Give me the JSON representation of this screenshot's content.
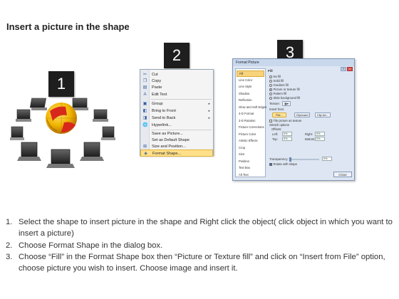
{
  "title": "Insert a picture in the shape",
  "steps": {
    "s1": {
      "number": "1"
    },
    "s2": {
      "number": "2"
    },
    "s3": {
      "number": "3"
    }
  },
  "context_menu": {
    "items": [
      {
        "label": "Cut",
        "icon": "scissors-icon"
      },
      {
        "label": "Copy",
        "icon": "copy-icon"
      },
      {
        "label": "Paste",
        "icon": "paste-icon"
      },
      {
        "label": "Edit Text",
        "icon": "edit-text-icon"
      },
      {
        "label": "Group",
        "icon": "group-icon"
      },
      {
        "label": "Bring to Front",
        "icon": "bring-front-icon"
      },
      {
        "label": "Send to Back",
        "icon": "send-back-icon"
      },
      {
        "label": "Hyperlink...",
        "icon": "hyperlink-icon"
      },
      {
        "label": "Save as Picture...",
        "icon": ""
      },
      {
        "label": "Set as Default Shape",
        "icon": ""
      },
      {
        "label": "Size and Position...",
        "icon": "size-position-icon"
      },
      {
        "label": "Format Shape...",
        "icon": "format-shape-icon"
      }
    ]
  },
  "dialog": {
    "title": "Format Picture",
    "nav": [
      "Fill",
      "Line Color",
      "Line Style",
      "Shadow",
      "Reflection",
      "Glow and Soft Edges",
      "3-D Format",
      "3-D Rotation",
      "Picture Corrections",
      "Picture Color",
      "Artistic Effects",
      "Crop",
      "Size",
      "Position",
      "Text Box",
      "Alt Text"
    ],
    "fill_heading": "Fill",
    "fill_options": [
      "No fill",
      "Solid fill",
      "Gradient fill",
      "Picture or texture fill",
      "Pattern fill",
      "Slide background fill"
    ],
    "texture_label": "Texture:",
    "insert_from": "Insert from:",
    "file_btn": "File...",
    "clipboard_btn": "Clipboard",
    "clipart_btn": "Clip Art...",
    "tile_label": "Tile picture as texture",
    "stretch_label": "Stretch options",
    "offsets_label": "Offsets:",
    "left_label": "Left:",
    "right_label": "Right:",
    "top_label": "Top:",
    "bottom_label": "Bottom:",
    "zero": "0%",
    "transparency_label": "Transparency:",
    "rotate_label": "Rotate with shape",
    "close_label": "Close"
  },
  "instructions": [
    {
      "n": "1.",
      "text": "Select the shape to insert picture in the shape and Right click the object( click object in which you want to insert a picture)"
    },
    {
      "n": "2.",
      "text": "Choose Format Shape in the dialog box."
    },
    {
      "n": "3.",
      "text": "Choose “Fill” in the Format Shape box then “Picture or Texture fill”  and click on “Insert from File” option, choose picture you wish to insert. Choose image and insert it."
    }
  ]
}
